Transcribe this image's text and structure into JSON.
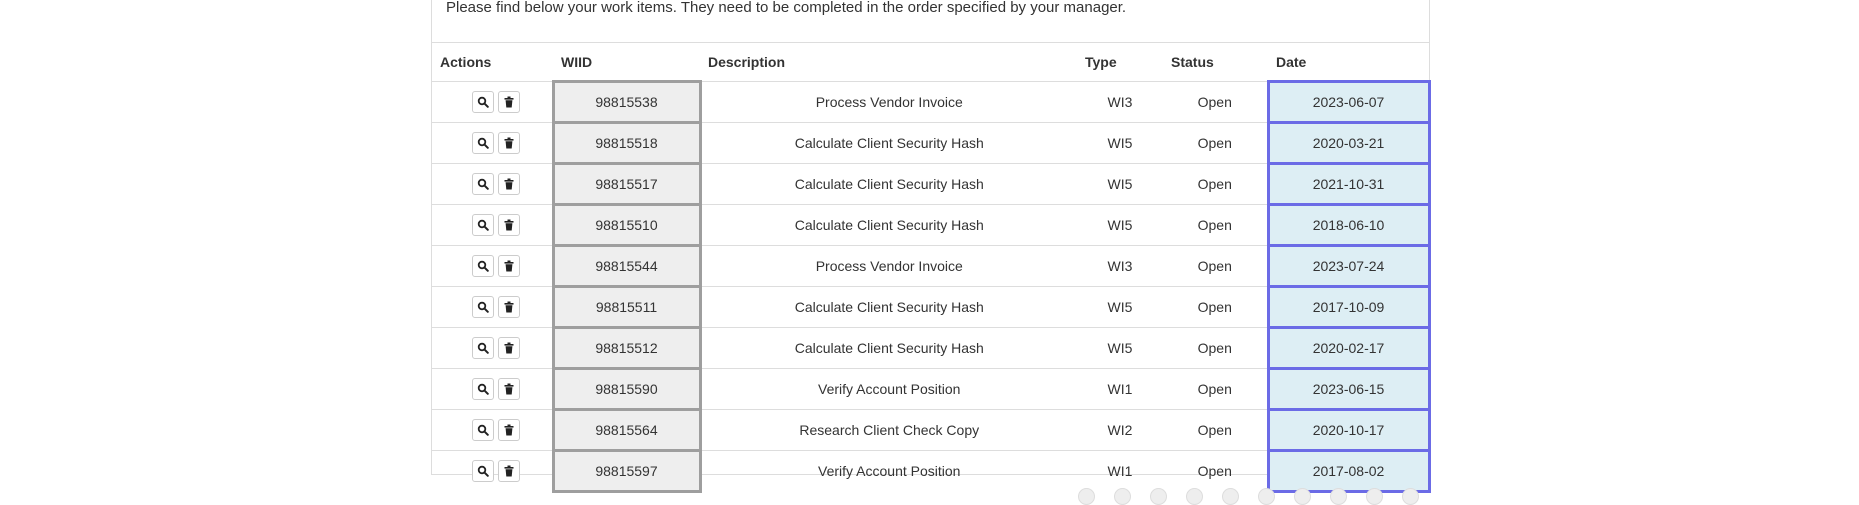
{
  "intro_text": "Please find below your work items. They need to be completed in the order specified by your manager.",
  "table": {
    "headers": {
      "actions": "Actions",
      "wiid": "WIID",
      "description": "Description",
      "type": "Type",
      "status": "Status",
      "date": "Date"
    },
    "rows": [
      {
        "wiid": "98815538",
        "description": "Process Vendor Invoice",
        "type": "WI3",
        "status": "Open",
        "date": "2023-06-07"
      },
      {
        "wiid": "98815518",
        "description": "Calculate Client Security Hash",
        "type": "WI5",
        "status": "Open",
        "date": "2020-03-21"
      },
      {
        "wiid": "98815517",
        "description": "Calculate Client Security Hash",
        "type": "WI5",
        "status": "Open",
        "date": "2021-10-31"
      },
      {
        "wiid": "98815510",
        "description": "Calculate Client Security Hash",
        "type": "WI5",
        "status": "Open",
        "date": "2018-06-10"
      },
      {
        "wiid": "98815544",
        "description": "Process Vendor Invoice",
        "type": "WI3",
        "status": "Open",
        "date": "2023-07-24"
      },
      {
        "wiid": "98815511",
        "description": "Calculate Client Security Hash",
        "type": "WI5",
        "status": "Open",
        "date": "2017-10-09"
      },
      {
        "wiid": "98815512",
        "description": "Calculate Client Security Hash",
        "type": "WI5",
        "status": "Open",
        "date": "2020-02-17"
      },
      {
        "wiid": "98815590",
        "description": "Verify Account Position",
        "type": "WI1",
        "status": "Open",
        "date": "2023-06-15"
      },
      {
        "wiid": "98815564",
        "description": "Research Client Check Copy",
        "type": "WI2",
        "status": "Open",
        "date": "2020-10-17"
      },
      {
        "wiid": "98815597",
        "description": "Verify Account Position",
        "type": "WI1",
        "status": "Open",
        "date": "2017-08-02"
      }
    ],
    "row_action_icons": [
      "search-icon",
      "trash-icon"
    ]
  },
  "pagination": {
    "page_count": 10
  },
  "colors": {
    "wiid_cell_bg": "#eeeeee",
    "wiid_cell_border": "#9e9e9e",
    "date_cell_bg": "#ddeef4",
    "date_cell_border": "#6b6be6"
  }
}
